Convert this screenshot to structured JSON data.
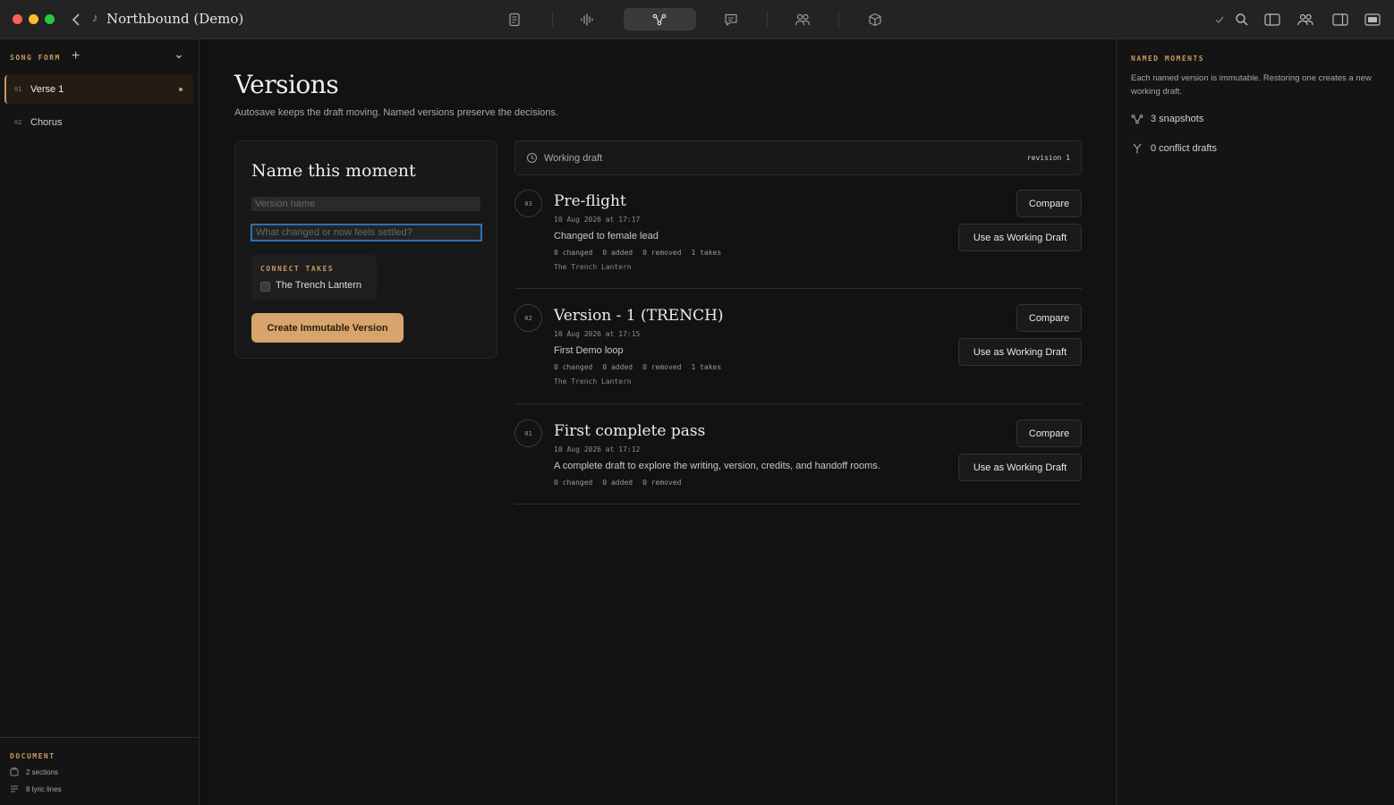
{
  "window": {
    "title": "Northbound (Demo)"
  },
  "toolbar": {
    "tabs": [
      {
        "icon": "document-icon",
        "active": false
      },
      {
        "icon": "waveform-icon",
        "active": false
      },
      {
        "icon": "version-graph-icon",
        "active": true
      },
      {
        "icon": "comment-icon",
        "active": false
      },
      {
        "icon": "people-icon",
        "active": false
      },
      {
        "icon": "package-icon",
        "active": false
      }
    ],
    "right_icons": [
      "checkmark-icon",
      "search-icon",
      "left-panel-icon",
      "collaborators-icon",
      "right-panel-icon",
      "fullscreen-icon"
    ]
  },
  "sidebar": {
    "song_form_label": "SONG FORM",
    "sections": [
      {
        "num": "01",
        "label": "Verse 1",
        "active": true
      },
      {
        "num": "02",
        "label": "Chorus",
        "active": false
      }
    ],
    "document_label": "DOCUMENT",
    "document_stats": [
      "2 sections",
      "8 lyric lines"
    ]
  },
  "main": {
    "title": "Versions",
    "subtitle": "Autosave keeps the draft moving. Named versions preserve the decisions.",
    "name_card": {
      "title": "Name this moment",
      "version_name_placeholder": "Version name",
      "change_note_placeholder": "What changed or now feels settled?",
      "connect_label": "CONNECT TAKES",
      "take_option": "The Trench Lantern",
      "create_button": "Create Immutable Version"
    },
    "working_draft": {
      "label": "Working draft",
      "revision": "revision 1"
    },
    "versions": [
      {
        "num": "03",
        "title": "Pre-flight",
        "date": "10 Aug 2026 at 17:17",
        "note": "Changed to female lead",
        "changed": "0 changed",
        "added": "0 added",
        "removed": "0 removed",
        "takes": "1 takes",
        "take_name": "The Trench Lantern"
      },
      {
        "num": "02",
        "title": "Version - 1 (TRENCH)",
        "date": "10 Aug 2026 at 17:15",
        "note": "First Demo loop",
        "changed": "0 changed",
        "added": "0 added",
        "removed": "0 removed",
        "takes": "1 takes",
        "take_name": "The Trench Lantern"
      },
      {
        "num": "01",
        "title": "First complete pass",
        "date": "10 Aug 2026 at 17:12",
        "note": "A complete draft to explore the writing, version, credits, and handoff rooms.",
        "changed": "0 changed",
        "added": "0 added",
        "removed": "0 removed"
      }
    ],
    "compare_label": "Compare",
    "use_label": "Use as Working Draft"
  },
  "right_panel": {
    "label": "NAMED MOMENTS",
    "description": "Each named version is immutable. Restoring one creates a new working draft.",
    "snapshots": "3 snapshots",
    "conflicts": "0 conflict drafts"
  },
  "colors": {
    "accent": "#c89a5e",
    "button_primary": "#d7a46c",
    "focus_ring": "#2d6fb3",
    "background": "#121212"
  }
}
